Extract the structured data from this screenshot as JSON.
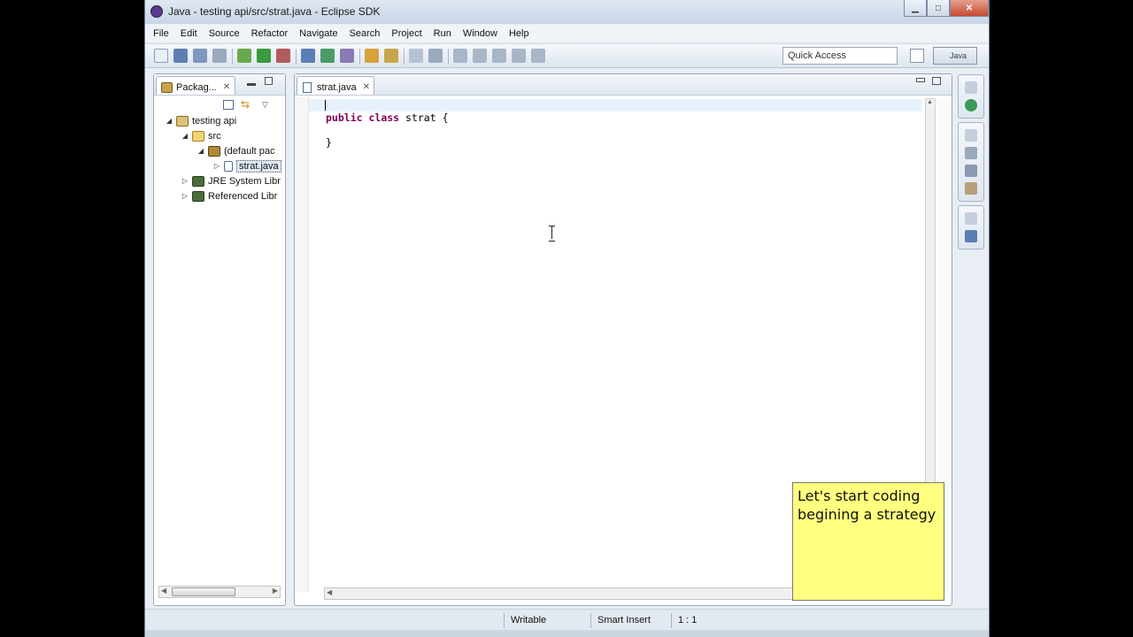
{
  "window": {
    "title": "Java - testing api/src/strat.java - Eclipse SDK",
    "min_glyph": "▁",
    "max_glyph": "□",
    "close_glyph": "✕"
  },
  "menu": [
    "File",
    "Edit",
    "Source",
    "Refactor",
    "Navigate",
    "Search",
    "Project",
    "Run",
    "Window",
    "Help"
  ],
  "toolbar": {
    "quick_access": "Quick Access",
    "perspective_label": "Java"
  },
  "package_explorer": {
    "tab_label": "Packag...",
    "close_glyph": "✕",
    "tree": [
      {
        "label": "testing api",
        "twisty": "◢",
        "icon": "project-icon"
      },
      {
        "label": "src",
        "twisty": "◢",
        "icon": "source-folder-icon"
      },
      {
        "label": "(default pac",
        "twisty": "◢",
        "icon": "package-icon"
      },
      {
        "label": "strat.java",
        "twisty": "▷",
        "icon": "java-file-icon"
      },
      {
        "label": "JRE System Libr",
        "twisty": "▷",
        "icon": "library-icon"
      },
      {
        "label": "Referenced Libr",
        "twisty": "▷",
        "icon": "library-icon"
      }
    ]
  },
  "editor": {
    "tab_label": "strat.java",
    "close_glyph": "✕",
    "code": {
      "kw1": "public",
      "kw2": "class",
      "rest": " strat {",
      "closing": "}"
    }
  },
  "note": {
    "text": "Let's start coding begining a strategy"
  },
  "status": {
    "writable": "Writable",
    "insert_mode": "Smart Insert",
    "position": "1 : 1"
  },
  "colors": {
    "keyword": "#7f0055",
    "note_bg": "#ffff80",
    "current_line": "#e8f2fe"
  }
}
